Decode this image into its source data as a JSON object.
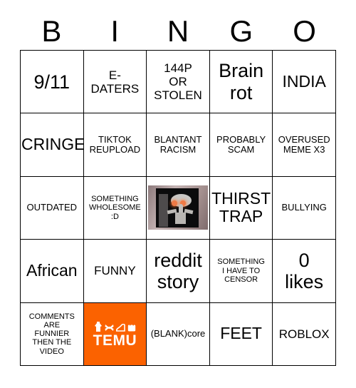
{
  "card": {
    "title_letters": [
      "B",
      "I",
      "N",
      "G",
      "O"
    ],
    "accent_color": "#fb6200",
    "grid_line_color": "#000000",
    "background_color": "#ffffff",
    "rows": [
      [
        {
          "text": "9/11",
          "size": "fs-xl",
          "kind": "text"
        },
        {
          "text": "E-\nDATERS",
          "size": "fs-md",
          "kind": "text"
        },
        {
          "text": "144P\nOR\nSTOLEN",
          "size": "fs-md",
          "kind": "text"
        },
        {
          "text": "Brain\nrot",
          "size": "fs-xl",
          "kind": "text"
        },
        {
          "text": "INDIA",
          "size": "fs-lg",
          "kind": "text"
        }
      ],
      [
        {
          "text": "CRINGE",
          "size": "fs-lg",
          "kind": "text"
        },
        {
          "text": "TIKTOK\nREUPLOAD",
          "size": "fs-sm",
          "kind": "text"
        },
        {
          "text": "BLANTANT\nRACISM",
          "size": "fs-sm",
          "kind": "text"
        },
        {
          "text": "PROBABLY\nSCAM",
          "size": "fs-sm",
          "kind": "text"
        },
        {
          "text": "OVERUSED\nMEME X3",
          "size": "fs-sm",
          "kind": "text"
        }
      ],
      [
        {
          "text": "OUTDATED",
          "size": "fs-sm",
          "kind": "text"
        },
        {
          "text": "SOMETHING\nWHOLESOME\n:D",
          "size": "fs-xs",
          "kind": "text"
        },
        {
          "text": "",
          "size": "fs-sm",
          "kind": "image",
          "image_name": "squidward-meme-photo"
        },
        {
          "text": "THIRST\nTRAP",
          "size": "fs-lg",
          "kind": "text"
        },
        {
          "text": "BULLYING",
          "size": "fs-sm",
          "kind": "text"
        }
      ],
      [
        {
          "text": "African",
          "size": "fs-lg",
          "kind": "text"
        },
        {
          "text": "FUNNY",
          "size": "fs-md",
          "kind": "text"
        },
        {
          "text": "reddit\nstory",
          "size": "fs-xl",
          "kind": "text"
        },
        {
          "text": "SOMETHING\nI HAVE TO\nCENSOR",
          "size": "fs-xs",
          "kind": "text"
        },
        {
          "text": "0\nlikes",
          "size": "fs-xl",
          "kind": "text"
        }
      ],
      [
        {
          "text": "COMMENTS\nARE\nFUNNIER\nTHEN THE\nVIDEO",
          "size": "fs-xs",
          "kind": "text"
        },
        {
          "text": "TEMU",
          "size": "fs-md",
          "kind": "logo",
          "logo_name": "temu-logo"
        },
        {
          "text": "(BLANK)core",
          "size": "fs-sm",
          "kind": "text"
        },
        {
          "text": "FEET",
          "size": "fs-lg",
          "kind": "text"
        },
        {
          "text": "ROBLOX",
          "size": "fs-md",
          "kind": "text"
        }
      ]
    ]
  }
}
